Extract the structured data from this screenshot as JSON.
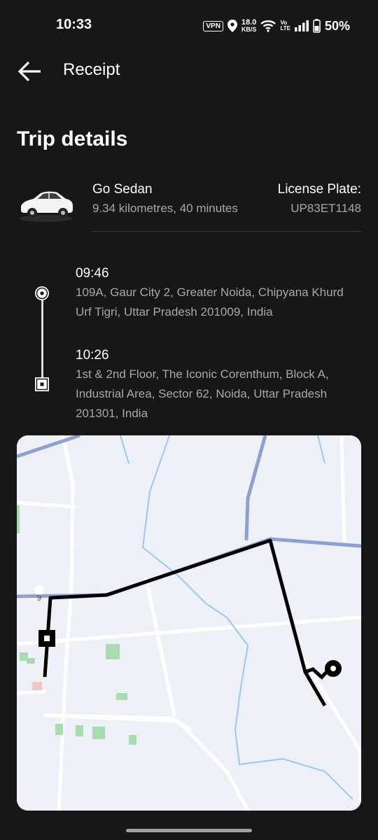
{
  "status_bar": {
    "time": "10:33",
    "vpn": "VPN",
    "speed_value": "18.0",
    "speed_unit": "KB/S",
    "volte_top": "Vo",
    "volte_bottom": "LTE",
    "battery": "50%",
    "icons": [
      "location-icon",
      "wifi-icon",
      "signal-icon",
      "battery-icon"
    ]
  },
  "app_bar": {
    "title": "Receipt",
    "back_icon": "arrow-left-icon"
  },
  "trip": {
    "section_title": "Trip details",
    "vehicle_type": "Go Sedan",
    "summary": "9.34 kilometres, 40 minutes",
    "plate_label": "License Plate:",
    "plate_value": "UP83ET1148"
  },
  "stops": [
    {
      "time": "09:46",
      "address": "109A, Gaur City 2, Greater Noida, Chipyana Khurd Urf Tigri, Uttar Pradesh 201009, India"
    },
    {
      "time": "10:26",
      "address": "1st & 2nd Floor, The Iconic Corenthum, Block A, Industrial Area, Sector 62, Noida, Uttar Pradesh 201301, India"
    }
  ],
  "map": {
    "road_label": "9"
  },
  "colors": {
    "background": "#171717",
    "text_secondary": "#a8a8a8",
    "map_background": "#eef0f8",
    "route": "#000000",
    "highway": "#8f9fd0",
    "water": "#9cc7f2",
    "park": "#a8dbb0"
  }
}
